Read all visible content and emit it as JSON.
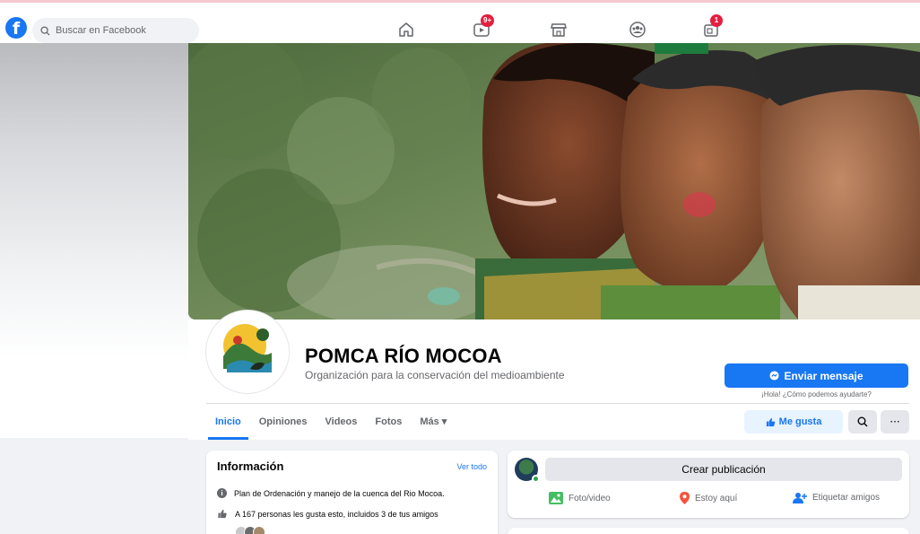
{
  "nav": {
    "search_placeholder": "Buscar en Facebook",
    "video_badge": "9+",
    "gaming_badge": "1",
    "icons": [
      "home-icon",
      "video-icon",
      "marketplace-icon",
      "groups-icon",
      "gaming-icon"
    ]
  },
  "page": {
    "name": "POMCA RÍO MOCOA",
    "category": "Organización para la conservación del medioambiente",
    "avatar_text": "POMCA RIO MOCOA"
  },
  "actions": {
    "send_message": "Enviar mensaje",
    "message_hint": "¡Hola! ¿Cómo podemos ayudarte?",
    "like": "Me gusta",
    "more": "···"
  },
  "tabs": [
    {
      "label": "Inicio",
      "active": true
    },
    {
      "label": "Opiniones"
    },
    {
      "label": "Videos"
    },
    {
      "label": "Fotos"
    },
    {
      "label": "Más ▾"
    }
  ],
  "info": {
    "title": "Información",
    "see_all": "Ver todo",
    "description": "Plan de Ordenación y manejo de la cuenca del Rio Mocoa.",
    "likes": "A 167 personas les gusta esto, incluidos 3 de tus amigos"
  },
  "composer": {
    "create_post": "Crear publicación",
    "photo_video": "Foto/video",
    "checkin": "Estoy aquí",
    "tag_friends": "Etiquetar amigos"
  },
  "colors": {
    "brand": "#1877f2",
    "badge": "#e41e3f",
    "photo_green": "#45bd62",
    "checkin_red": "#f5533d",
    "tag_blue": "#1877f2"
  }
}
